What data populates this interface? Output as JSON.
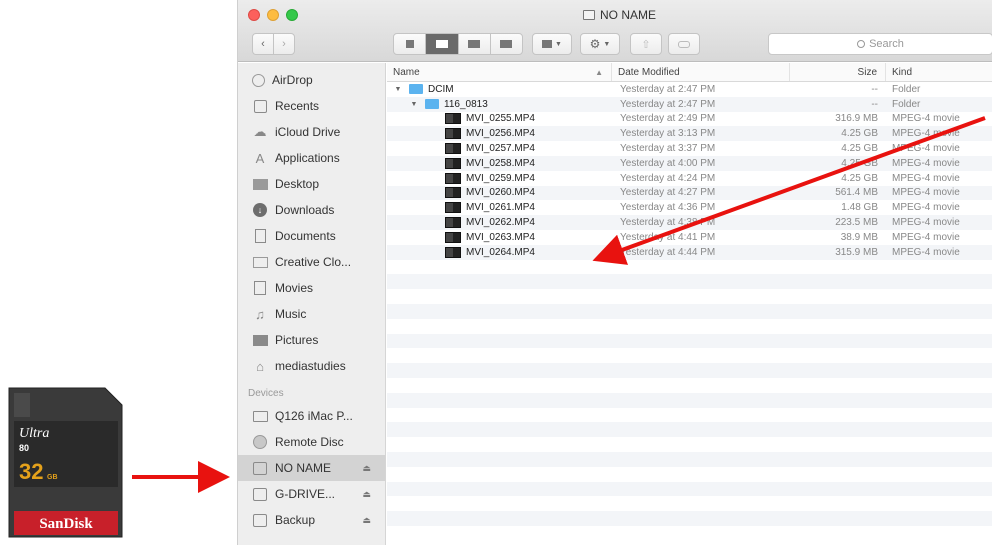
{
  "window": {
    "title": "NO NAME"
  },
  "toolbar": {
    "back_label": "‹",
    "forward_label": "›",
    "search_placeholder": "Search"
  },
  "sidebar": {
    "favorites": [
      {
        "label": "AirDrop",
        "icon": "airdrop-icon"
      },
      {
        "label": "Recents",
        "icon": "recents-icon"
      },
      {
        "label": "iCloud Drive",
        "icon": "cloud-icon"
      },
      {
        "label": "Applications",
        "icon": "applications-icon"
      },
      {
        "label": "Desktop",
        "icon": "desktop-icon"
      },
      {
        "label": "Downloads",
        "icon": "downloads-icon"
      },
      {
        "label": "Documents",
        "icon": "documents-icon"
      },
      {
        "label": "Creative Clo...",
        "icon": "folder-icon"
      },
      {
        "label": "Movies",
        "icon": "movies-icon"
      },
      {
        "label": "Music",
        "icon": "music-icon"
      },
      {
        "label": "Pictures",
        "icon": "pictures-icon"
      },
      {
        "label": "mediastudies",
        "icon": "home-icon"
      }
    ],
    "devices_header": "Devices",
    "devices": [
      {
        "label": "Q126 iMac P...",
        "icon": "imac-icon",
        "eject": false
      },
      {
        "label": "Remote Disc",
        "icon": "disc-icon",
        "eject": false
      },
      {
        "label": "NO NAME",
        "icon": "drive-icon",
        "eject": true,
        "selected": true
      },
      {
        "label": "G-DRIVE...",
        "icon": "drive-icon",
        "eject": true
      },
      {
        "label": "Backup",
        "icon": "drive-icon",
        "eject": true
      }
    ],
    "eject_symbol": "⏏"
  },
  "columns": {
    "name": "Name",
    "date": "Date Modified",
    "size": "Size",
    "kind": "Kind"
  },
  "files": [
    {
      "name": "DCIM",
      "date": "Yesterday at 2:47 PM",
      "size": "--",
      "kind": "Folder",
      "level": 0,
      "type": "folder"
    },
    {
      "name": "116_0813",
      "date": "Yesterday at 2:47 PM",
      "size": "--",
      "kind": "Folder",
      "level": 1,
      "type": "folder"
    },
    {
      "name": "MVI_0255.MP4",
      "date": "Yesterday at 2:49 PM",
      "size": "316.9 MB",
      "kind": "MPEG-4 movie",
      "level": 2,
      "type": "movie"
    },
    {
      "name": "MVI_0256.MP4",
      "date": "Yesterday at 3:13 PM",
      "size": "4.25 GB",
      "kind": "MPEG-4 movie",
      "level": 2,
      "type": "movie"
    },
    {
      "name": "MVI_0257.MP4",
      "date": "Yesterday at 3:37 PM",
      "size": "4.25 GB",
      "kind": "MPEG-4 movie",
      "level": 2,
      "type": "movie"
    },
    {
      "name": "MVI_0258.MP4",
      "date": "Yesterday at 4:00 PM",
      "size": "4.25 GB",
      "kind": "MPEG-4 movie",
      "level": 2,
      "type": "movie"
    },
    {
      "name": "MVI_0259.MP4",
      "date": "Yesterday at 4:24 PM",
      "size": "4.25 GB",
      "kind": "MPEG-4 movie",
      "level": 2,
      "type": "movie"
    },
    {
      "name": "MVI_0260.MP4",
      "date": "Yesterday at 4:27 PM",
      "size": "561.4 MB",
      "kind": "MPEG-4 movie",
      "level": 2,
      "type": "movie"
    },
    {
      "name": "MVI_0261.MP4",
      "date": "Yesterday at 4:36 PM",
      "size": "1.48 GB",
      "kind": "MPEG-4 movie",
      "level": 2,
      "type": "movie"
    },
    {
      "name": "MVI_0262.MP4",
      "date": "Yesterday at 4:38 PM",
      "size": "223.5 MB",
      "kind": "MPEG-4 movie",
      "level": 2,
      "type": "movie"
    },
    {
      "name": "MVI_0263.MP4",
      "date": "Yesterday at 4:41 PM",
      "size": "38.9 MB",
      "kind": "MPEG-4 movie",
      "level": 2,
      "type": "movie"
    },
    {
      "name": "MVI_0264.MP4",
      "date": "Yesterday at 4:44 PM",
      "size": "315.9 MB",
      "kind": "MPEG-4 movie",
      "level": 2,
      "type": "movie"
    }
  ],
  "sdcard": {
    "brand": "SanDisk",
    "series": "Ultra",
    "speed": "80",
    "capacity": "32",
    "unit": "GB"
  },
  "colors": {
    "arrow": "#e8120f",
    "folder": "#5bb3ef",
    "sdcard_body": "#3a3a3a",
    "sdcard_red": "#c8202a"
  }
}
